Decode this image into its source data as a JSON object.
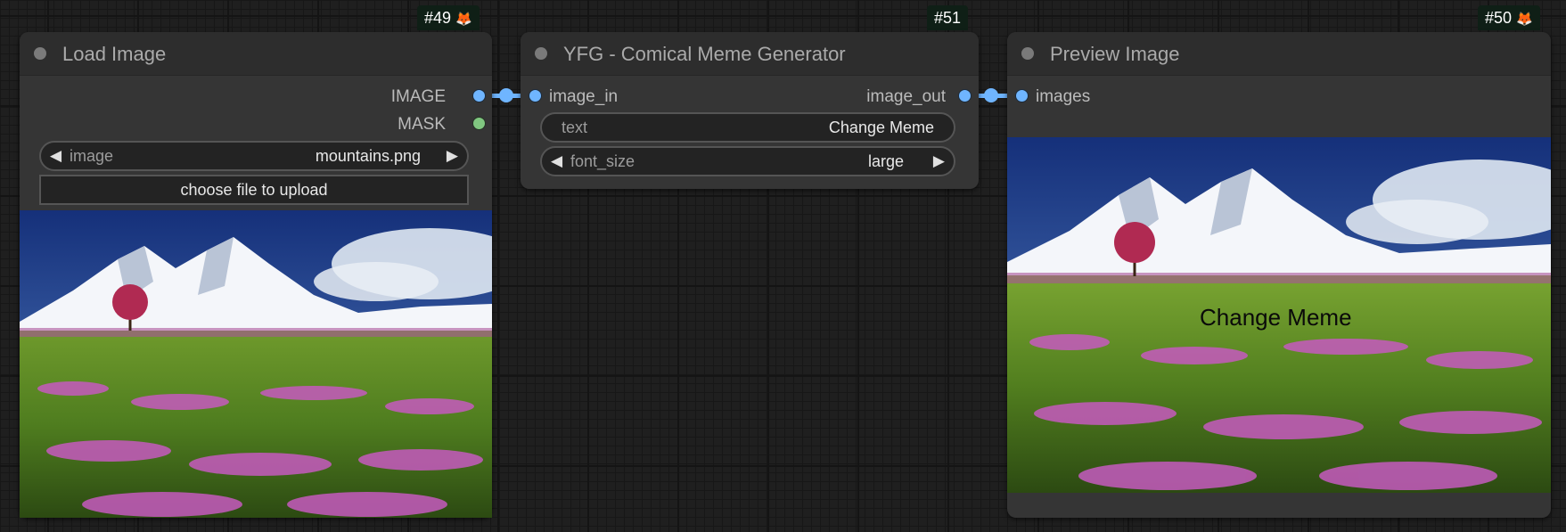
{
  "nodes": {
    "load_image": {
      "id": "#49",
      "title": "Load Image",
      "outputs": [
        "IMAGE",
        "MASK"
      ],
      "widget": {
        "label": "image",
        "value": "mountains.png"
      },
      "upload_button": "choose file to upload"
    },
    "meme": {
      "id": "#51",
      "title": "YFG - Comical Meme Generator",
      "input": "image_in",
      "output": "image_out",
      "text_widget": {
        "label": "text",
        "value": "Change Meme"
      },
      "font_widget": {
        "label": "font_size",
        "value": "large"
      }
    },
    "preview": {
      "id": "#50",
      "title": "Preview Image",
      "input": "images",
      "overlay_text": "Change Meme"
    }
  },
  "colors": {
    "image_link": "#6fb5ff",
    "mask_slot": "#80c780",
    "node_bg": "#353535",
    "canvas_bg": "#1f1f1f"
  },
  "icons": {
    "badge_icon": "fox-icon",
    "arrow_left": "left-arrow-icon",
    "arrow_right": "right-arrow-icon"
  }
}
